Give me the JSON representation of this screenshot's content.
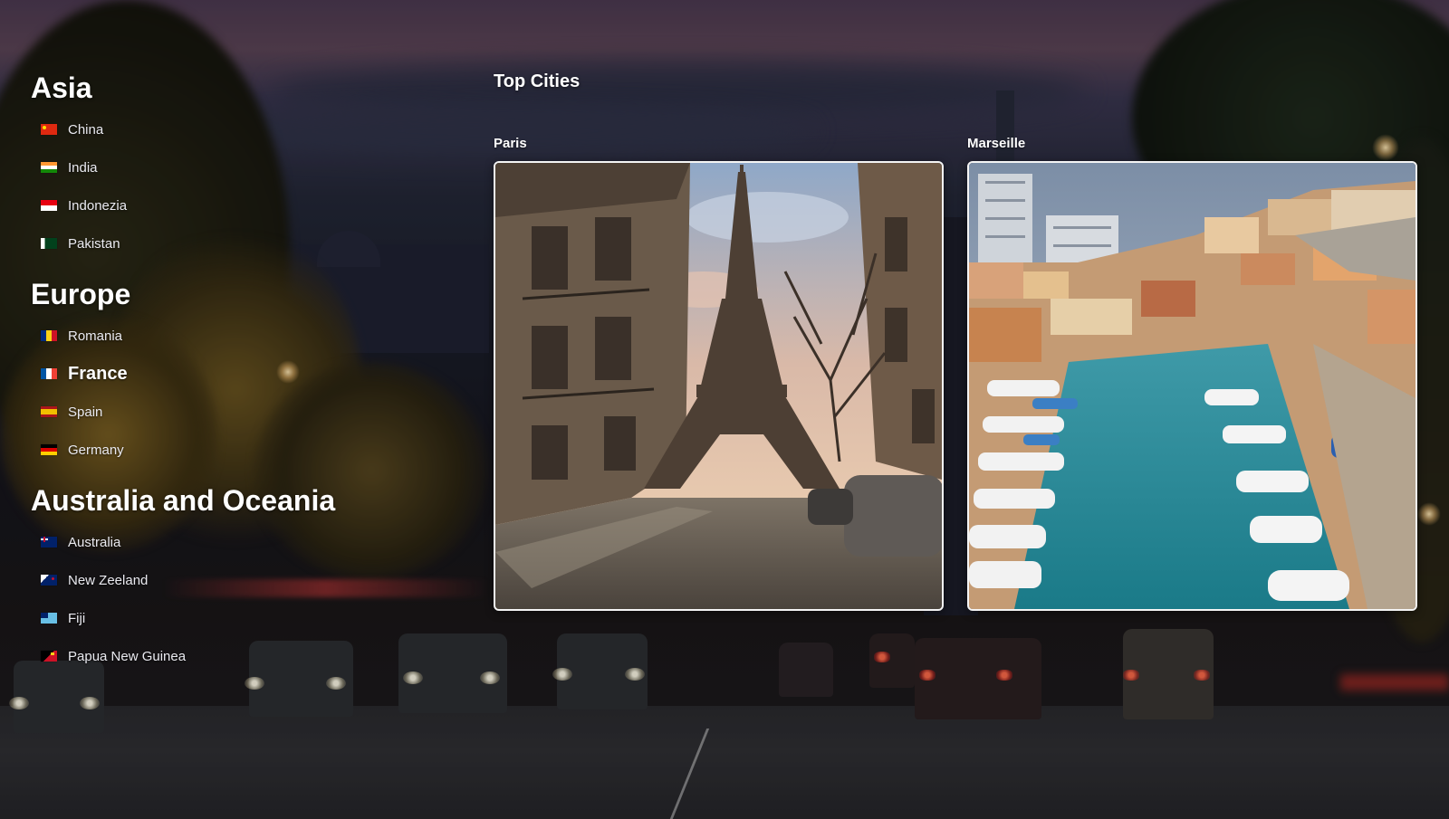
{
  "regions": [
    {
      "title": "Asia",
      "countries": [
        {
          "name": "China",
          "flag": "flag-china"
        },
        {
          "name": "India",
          "flag": "flag-india"
        },
        {
          "name": "Indonezia",
          "flag": "flag-indonesia"
        },
        {
          "name": "Pakistan",
          "flag": "flag-pakistan"
        }
      ]
    },
    {
      "title": "Europe",
      "countries": [
        {
          "name": "Romania",
          "flag": "flag-romania"
        },
        {
          "name": "France",
          "flag": "flag-france",
          "active": true
        },
        {
          "name": "Spain",
          "flag": "flag-spain"
        },
        {
          "name": "Germany",
          "flag": "flag-germany"
        }
      ]
    },
    {
      "title": "Australia and Oceania",
      "countries": [
        {
          "name": "Australia",
          "flag": "flag-australia"
        },
        {
          "name": "New Zeeland",
          "flag": "flag-nz"
        },
        {
          "name": "Fiji",
          "flag": "flag-fiji"
        },
        {
          "name": "Papua New Guinea",
          "flag": "flag-png"
        }
      ]
    }
  ],
  "main": {
    "section_title": "Top Cities",
    "cities": [
      {
        "name": "Paris",
        "image": "eiffel-tower-photo"
      },
      {
        "name": "Marseille",
        "image": "marseille-harbor-photo"
      }
    ]
  },
  "colors": {
    "card_border": "#f4f4f4",
    "text": "#ffffff",
    "sky_dusk": "#4d3a52"
  }
}
